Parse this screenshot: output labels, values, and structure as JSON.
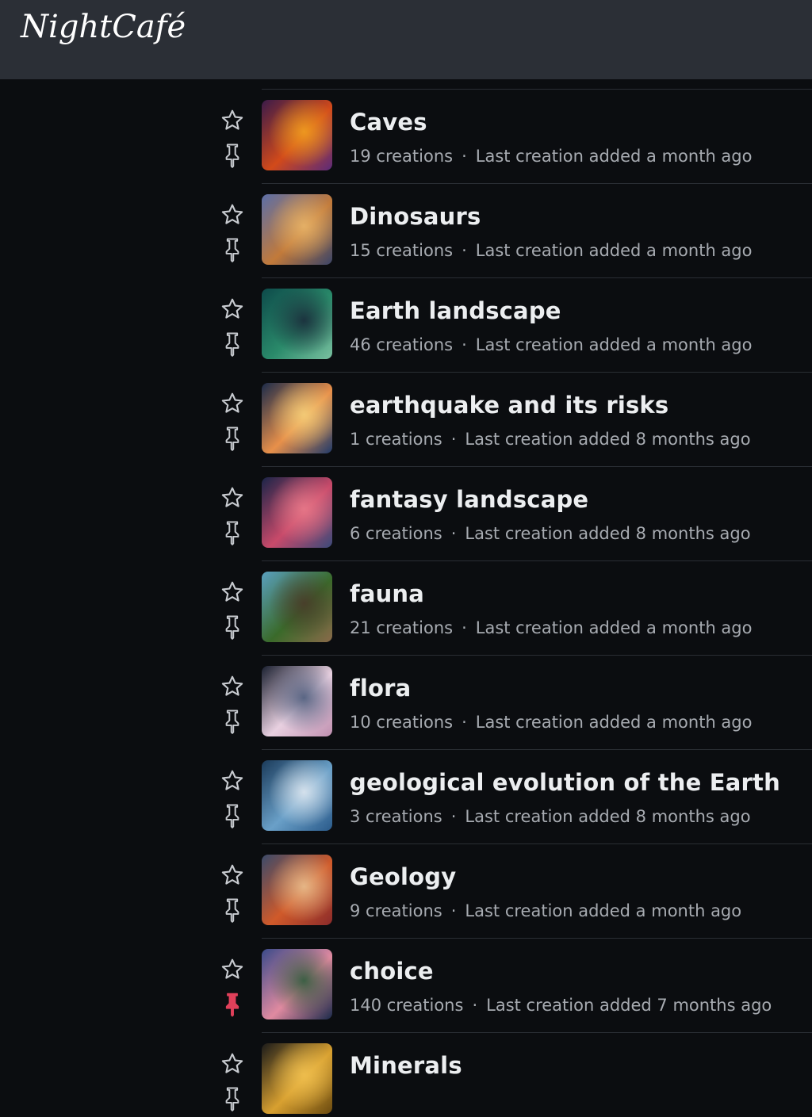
{
  "app": {
    "logo_text": "NightCafé"
  },
  "collections": [
    {
      "title": "Caves",
      "count": "19 creations",
      "last_added": "Last creation added a month ago",
      "pinned": false,
      "thumb_colors": [
        "#3a1a4a",
        "#d24a1a",
        "#f0a020",
        "#5a2a7a"
      ]
    },
    {
      "title": "Dinosaurs",
      "count": "15 creations",
      "last_added": "Last creation added a month ago",
      "pinned": false,
      "thumb_colors": [
        "#5a6ea8",
        "#c27a3a",
        "#e8b56a",
        "#3a4468"
      ]
    },
    {
      "title": "Earth landscape",
      "count": "46 creations",
      "last_added": "Last creation added a month ago",
      "pinned": false,
      "thumb_colors": [
        "#0d4a4a",
        "#2a8a6a",
        "#1a2a3a",
        "#7ac0a0"
      ]
    },
    {
      "title": "earthquake and its risks",
      "count": "1 creations",
      "last_added": "Last creation added 8 months ago",
      "pinned": false,
      "thumb_colors": [
        "#1a2a4a",
        "#e8904a",
        "#f4d07a",
        "#203a6a"
      ]
    },
    {
      "title": "fantasy landscape",
      "count": "6 creations",
      "last_added": "Last creation added 8 months ago",
      "pinned": false,
      "thumb_colors": [
        "#1a2448",
        "#c84a6a",
        "#e87a8a",
        "#3a4a7a"
      ]
    },
    {
      "title": "fauna",
      "count": "21 creations",
      "last_added": "Last creation added a month ago",
      "pinned": false,
      "thumb_colors": [
        "#5aa0c0",
        "#3a6a2a",
        "#4a3a2a",
        "#8a6a4a"
      ]
    },
    {
      "title": "flora",
      "count": "10 creations",
      "last_added": "Last creation added a month ago",
      "pinned": false,
      "thumb_colors": [
        "#1a2030",
        "#e8d0e0",
        "#4a5a7a",
        "#c090b0"
      ]
    },
    {
      "title": "geological evolution of the Earth",
      "count": "3 creations",
      "last_added": "Last creation added 8 months ago",
      "pinned": false,
      "thumb_colors": [
        "#1a3a5a",
        "#6aa0c8",
        "#e0e8f0",
        "#2a5a8a"
      ]
    },
    {
      "title": "Geology",
      "count": "9 creations",
      "last_added": "Last creation added a month ago",
      "pinned": false,
      "thumb_colors": [
        "#3a4a6a",
        "#d05a2a",
        "#e8c090",
        "#8a2a2a"
      ]
    },
    {
      "title": "choice",
      "count": "140 creations",
      "last_added": "Last creation added 7 months ago",
      "pinned": true,
      "thumb_colors": [
        "#3a4a8a",
        "#e08aa0",
        "#2a5a3a",
        "#1a2a4a"
      ]
    },
    {
      "title": "Minerals",
      "count": "",
      "last_added": "",
      "pinned": false,
      "thumb_colors": [
        "#1a1a1a",
        "#d8a030",
        "#f0c050",
        "#6a4a10"
      ]
    }
  ],
  "colors": {
    "icon_default": "#c8cbd0",
    "pin_active": "#e0405a",
    "background": "#0b0d10",
    "topbar": "#2b2f36"
  },
  "icons": {
    "favorite": "star-outline-icon",
    "pin": "pushpin-icon"
  }
}
